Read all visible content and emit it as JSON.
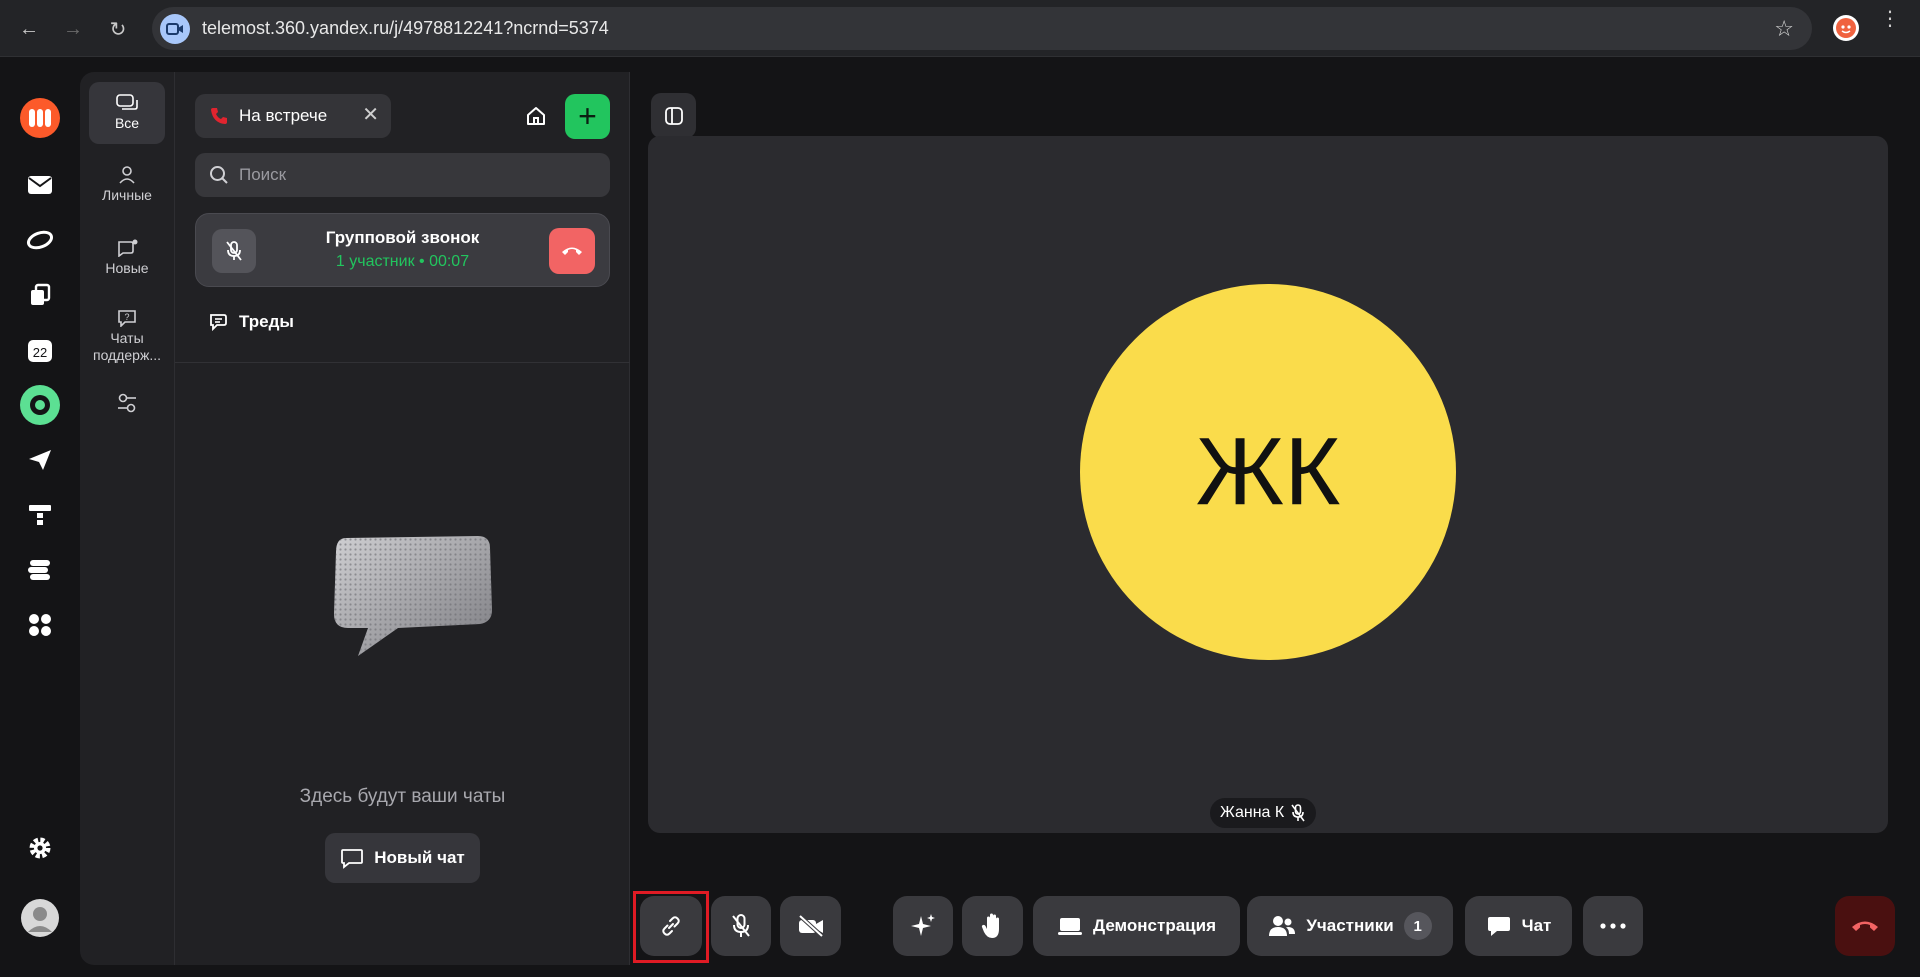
{
  "browser": {
    "url": "telemost.360.yandex.ru/j/4978812241?ncrnd=5374"
  },
  "filters": [
    {
      "label": "Все"
    },
    {
      "label": "Личные"
    },
    {
      "label": "Новые"
    },
    {
      "label": "Чаты поддерж..."
    }
  ],
  "chatpanel": {
    "meeting_chip": "На встрече",
    "search_placeholder": "Поиск",
    "call": {
      "title": "Групповой звонок",
      "subtitle": "1 участник • 00:07"
    },
    "threads_label": "Треды",
    "empty_text": "Здесь будут ваши чаты",
    "new_chat_label": "Новый чат"
  },
  "video": {
    "initials": "ЖК",
    "name": "Жанна К",
    "avatar_color": "#fadc4b"
  },
  "controls": {
    "screen_share": "Демонстрация",
    "participants": "Участники",
    "participants_count": "1",
    "chat": "Чат"
  },
  "colors": {
    "accent_green": "#22c55e",
    "end_call": "#f26464",
    "highlight": "#e01b24"
  }
}
